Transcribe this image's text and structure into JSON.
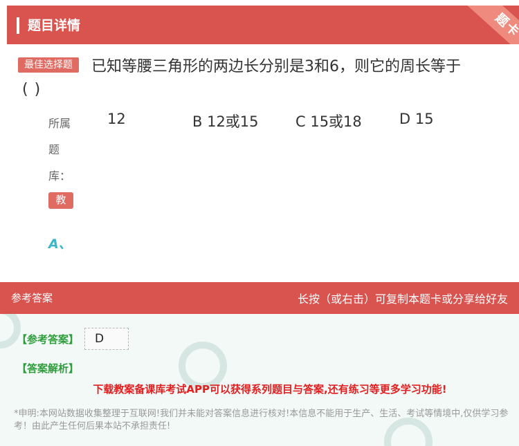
{
  "header": {
    "title": "题目详情",
    "corner_ribbon": "题卡"
  },
  "question": {
    "badge": "最佳选择题",
    "text": "已知等腰三角形的两边长分别是3和6，则它的周长等于",
    "paren": "(          )",
    "bank_label_lines": [
      "所属",
      "题",
      "库："
    ],
    "bank_tag": "教",
    "options": [
      "12",
      "B 12或15",
      "C 15或18",
      "D 15"
    ],
    "selected_label": "A、"
  },
  "answer_bar": {
    "left": "参考答案",
    "right": "长按（或右击）可复制本题卡或分享给好友"
  },
  "answer_section": {
    "ref_label": "【参考答案】",
    "answer_value": "D",
    "explanation_label": "【答案解析】",
    "promo": "下载教案备课库考试APP可以获得系列题目与答案,还有练习等更多学习功能!",
    "disclaimer": "*申明:本网站数据收集整理于互联网!我们并未能对答案信息进行核对!本信息不能用于生产、生活、考试等情境中,仅供学习参考！由此产生任何后果本站不承担责任!"
  },
  "colors": {
    "header_red": "#d9534f",
    "badge_red": "#e06b63",
    "accent_teal": "#3bb6c9",
    "label_green": "#2e9e3c",
    "promo_red": "#e02020"
  }
}
